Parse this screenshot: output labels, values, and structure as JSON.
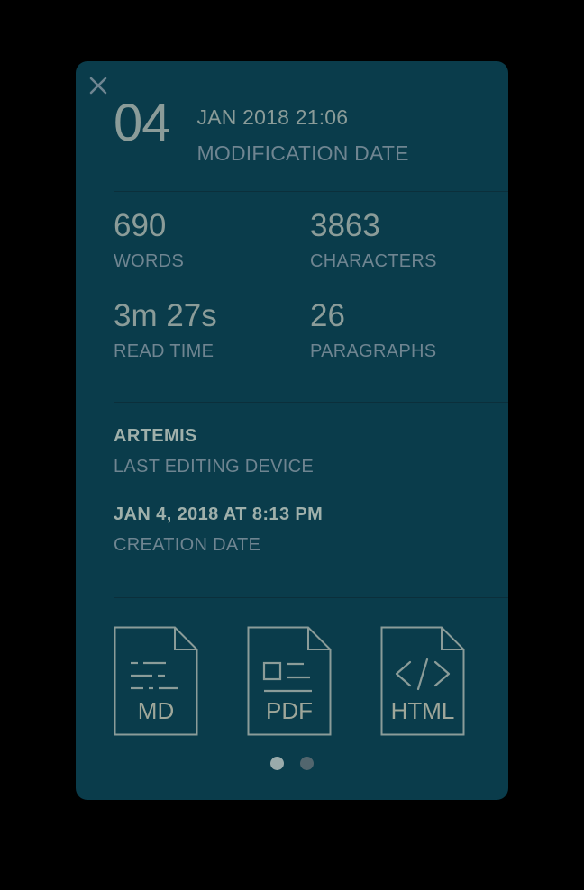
{
  "panel": {
    "background_color": "#0a3c4b",
    "divider_color": "#0b2f3b",
    "value_color": "#8b9c99",
    "label_color": "#6f8591",
    "accent_color": "#9fb0ab"
  },
  "close": {
    "icon": "close-icon",
    "label": "×"
  },
  "header": {
    "day": "04",
    "value": "JAN 2018 21:06",
    "label": "MODIFICATION DATE"
  },
  "stats": [
    {
      "value": "690",
      "label": "WORDS"
    },
    {
      "value": "3863",
      "label": "CHARACTERS"
    },
    {
      "value": "3m 27s",
      "label": "READ TIME"
    },
    {
      "value": "26",
      "label": "PARAGRAPHS"
    }
  ],
  "info": [
    {
      "value": "ARTEMIS",
      "label": "LAST EDITING DEVICE"
    },
    {
      "value": "JAN 4, 2018 AT 8:13 PM",
      "label": "CREATION DATE"
    }
  ],
  "exports": [
    {
      "label": "MD",
      "icon": "markdown-file-icon"
    },
    {
      "label": "PDF",
      "icon": "pdf-file-icon"
    },
    {
      "label": "HTML",
      "icon": "html-file-icon"
    }
  ],
  "pagination": {
    "total": 2,
    "active_index": 0,
    "dots": [
      {
        "state": "active"
      },
      {
        "state": "inactive"
      }
    ]
  }
}
